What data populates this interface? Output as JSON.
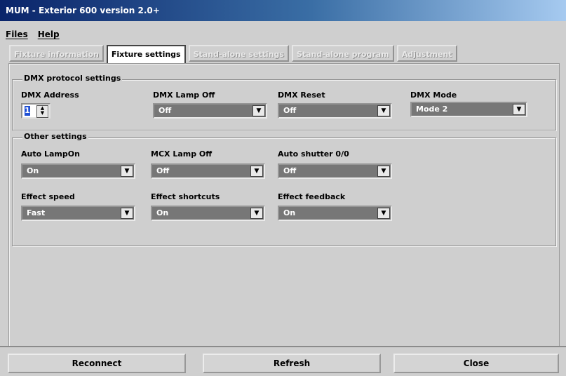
{
  "window": {
    "title": "MUM - Exterior 600 version 2.0+"
  },
  "menu": {
    "files": "Files",
    "help": "Help"
  },
  "tabs": [
    {
      "label": "Fixture information",
      "active": false
    },
    {
      "label": "Fixture settings",
      "active": true
    },
    {
      "label": "Stand-alone settings",
      "active": false
    },
    {
      "label": "Stand-alone program",
      "active": false
    },
    {
      "label": "Adjustment",
      "active": false
    }
  ],
  "dmx": {
    "group_label": "DMX protocol settings",
    "address_label": "DMX Address",
    "address_value": "1",
    "lamp_off_label": "DMX Lamp Off",
    "lamp_off_value": "Off",
    "reset_label": "DMX Reset",
    "reset_value": "Off",
    "mode_label": "DMX Mode",
    "mode_value": "Mode 2"
  },
  "other": {
    "group_label": "Other settings",
    "auto_lamp_label": "Auto LampOn",
    "auto_lamp_value": "On",
    "mcx_lamp_label": "MCX Lamp Off",
    "mcx_lamp_value": "Off",
    "auto_shutter_label": "Auto shutter 0/0",
    "auto_shutter_value": "Off",
    "effect_speed_label": "Effect speed",
    "effect_speed_value": "Fast",
    "effect_shortcuts_label": "Effect shortcuts",
    "effect_shortcuts_value": "On",
    "effect_feedback_label": "Effect feedback",
    "effect_feedback_value": "On"
  },
  "buttons": {
    "reconnect": "Reconnect",
    "refresh": "Refresh",
    "close": "Close"
  }
}
